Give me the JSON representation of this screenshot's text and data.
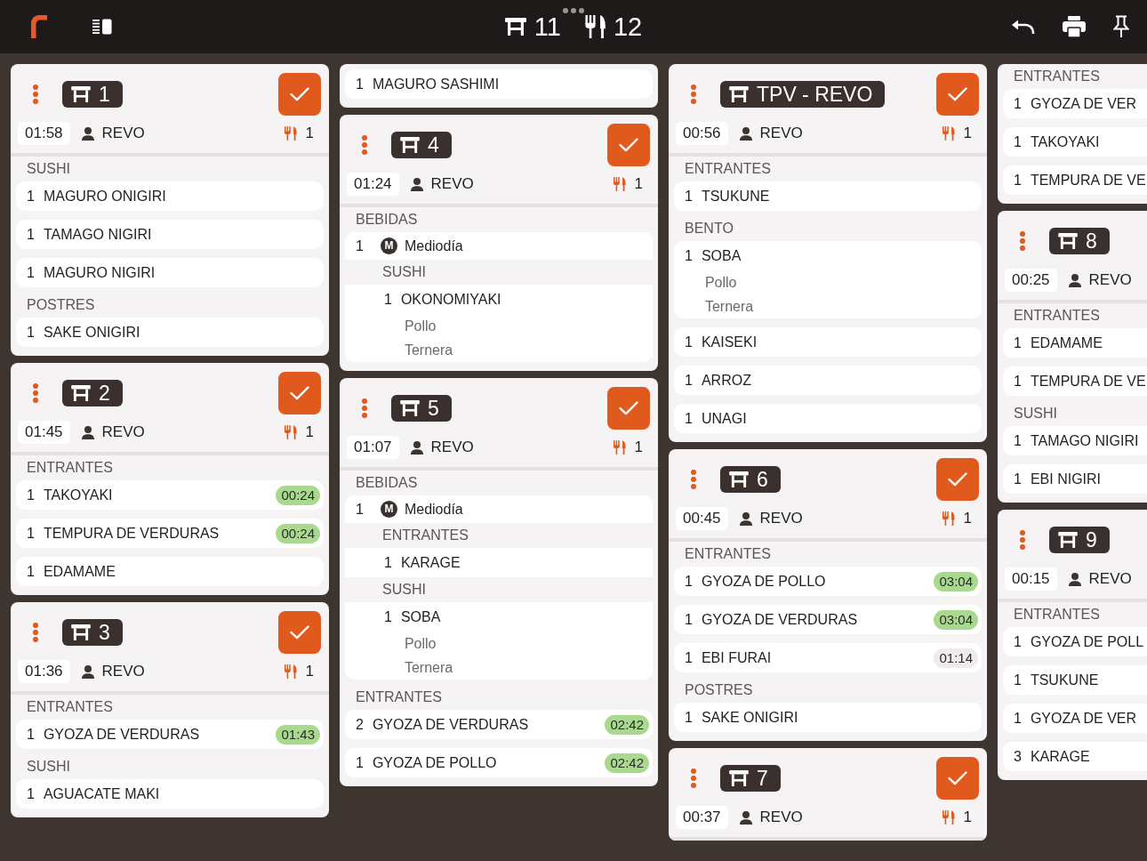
{
  "toolbar": {
    "tables_count": "11",
    "covers_count": "12"
  },
  "columns": [
    {
      "clipped": false,
      "tickets": [
        {
          "kind": "ticket",
          "table": "1",
          "elapsed": "01:58",
          "waiter": "REVO",
          "covers": "1",
          "groups": [
            {
              "course": "SUSHI",
              "items": [
                {
                  "kind": "dish",
                  "qty": "1",
                  "name": "MAGURO ONIGIRI"
                },
                {
                  "kind": "dish",
                  "qty": "1",
                  "name": "TAMAGO NIGIRI"
                },
                {
                  "kind": "dish",
                  "qty": "1",
                  "name": "MAGURO NIGIRI"
                }
              ]
            },
            {
              "course": "POSTRES",
              "items": [
                {
                  "kind": "dish",
                  "qty": "1",
                  "name": "SAKE ONIGIRI"
                }
              ]
            }
          ]
        },
        {
          "kind": "ticket",
          "table": "2",
          "elapsed": "01:45",
          "waiter": "REVO",
          "covers": "1",
          "groups": [
            {
              "course": "ENTRANTES",
              "items": [
                {
                  "kind": "dish",
                  "qty": "1",
                  "name": "TAKOYAKI",
                  "timer": "00:24",
                  "color": "#a8d98e"
                },
                {
                  "kind": "dish",
                  "qty": "1",
                  "name": "TEMPURA DE VERDURAS",
                  "timer": "00:24",
                  "color": "#a8d98e"
                },
                {
                  "kind": "dish",
                  "qty": "1",
                  "name": "EDAMAME"
                }
              ]
            }
          ]
        },
        {
          "kind": "ticket",
          "table": "3",
          "elapsed": "01:36",
          "waiter": "REVO",
          "covers": "1",
          "groups": [
            {
              "course": "ENTRANTES",
              "items": [
                {
                  "kind": "dish",
                  "qty": "1",
                  "name": "GYOZA DE VERDURAS",
                  "timer": "01:43",
                  "color": "#a8d98e"
                }
              ]
            },
            {
              "course": "SUSHI",
              "items": [
                {
                  "kind": "dish",
                  "qty": "1",
                  "name": "AGUACATE MAKI"
                }
              ]
            }
          ]
        }
      ]
    },
    {
      "clipped": false,
      "tickets": [
        {
          "kind": "continuation",
          "groups": [
            {
              "items": [
                {
                  "kind": "dish",
                  "qty": "1",
                  "name": "MAGURO SASHIMI"
                }
              ]
            }
          ]
        },
        {
          "kind": "ticket",
          "table": "4",
          "elapsed": "01:24",
          "waiter": "REVO",
          "covers": "1",
          "groups": [
            {
              "course": "BEBIDAS",
              "items": [
                {
                  "kind": "menu",
                  "qty": "1",
                  "badge": "M",
                  "name": "Mediodía",
                  "sections": [
                    {
                      "course": "SUSHI",
                      "items": [
                        {
                          "kind": "dish",
                          "qty": "1",
                          "name": "OKONOMIYAKI",
                          "modifiers": [
                            "Pollo",
                            "Ternera"
                          ]
                        }
                      ]
                    }
                  ]
                }
              ]
            }
          ]
        },
        {
          "kind": "ticket",
          "table": "5",
          "elapsed": "01:07",
          "waiter": "REVO",
          "covers": "1",
          "groups": [
            {
              "course": "BEBIDAS",
              "items": [
                {
                  "kind": "menu",
                  "qty": "1",
                  "badge": "M",
                  "name": "Mediodía",
                  "sections": [
                    {
                      "course": "ENTRANTES",
                      "items": [
                        {
                          "kind": "dish",
                          "qty": "1",
                          "name": "KARAGE"
                        }
                      ]
                    },
                    {
                      "course": "SUSHI",
                      "items": [
                        {
                          "kind": "dish",
                          "qty": "1",
                          "name": "SOBA",
                          "modifiers": [
                            "Pollo",
                            "Ternera"
                          ]
                        }
                      ]
                    }
                  ]
                }
              ]
            },
            {
              "course": "ENTRANTES",
              "items": [
                {
                  "kind": "dish",
                  "qty": "2",
                  "name": "GYOZA DE VERDURAS",
                  "timer": "02:42",
                  "color": "#a8d98e"
                },
                {
                  "kind": "dish",
                  "qty": "1",
                  "name": "GYOZA DE POLLO",
                  "timer": "02:42",
                  "color": "#a8d98e"
                }
              ]
            }
          ]
        }
      ]
    },
    {
      "clipped": false,
      "tickets": [
        {
          "kind": "ticket",
          "table": "TPV - REVO",
          "elapsed": "00:56",
          "waiter": "REVO",
          "covers": "1",
          "groups": [
            {
              "course": "ENTRANTES",
              "items": [
                {
                  "kind": "dish",
                  "qty": "1",
                  "name": "TSUKUNE"
                }
              ]
            },
            {
              "course": "BENTO",
              "items": [
                {
                  "kind": "dish",
                  "qty": "1",
                  "name": "SOBA",
                  "modifiers": [
                    "Pollo",
                    "Ternera"
                  ]
                },
                {
                  "kind": "dish",
                  "qty": "1",
                  "name": "KAISEKI"
                },
                {
                  "kind": "dish",
                  "qty": "1",
                  "name": "ARROZ"
                },
                {
                  "kind": "dish",
                  "qty": "1",
                  "name": "UNAGI"
                }
              ]
            }
          ]
        },
        {
          "kind": "ticket",
          "table": "6",
          "elapsed": "00:45",
          "waiter": "REVO",
          "covers": "1",
          "groups": [
            {
              "course": "ENTRANTES",
              "items": [
                {
                  "kind": "dish",
                  "qty": "1",
                  "name": "GYOZA DE POLLO",
                  "timer": "03:04",
                  "color": "#a8d98e"
                },
                {
                  "kind": "dish",
                  "qty": "1",
                  "name": "GYOZA DE VERDURAS",
                  "timer": "03:04",
                  "color": "#a8d98e"
                },
                {
                  "kind": "dish",
                  "qty": "1",
                  "name": "EBI FURAI",
                  "timer": "01:14",
                  "color": "#eeebea"
                }
              ]
            },
            {
              "course": "POSTRES",
              "items": [
                {
                  "kind": "dish",
                  "qty": "1",
                  "name": "SAKE ONIGIRI"
                }
              ]
            }
          ]
        },
        {
          "kind": "ticket",
          "table": "7",
          "elapsed": "00:37",
          "waiter": "REVO",
          "covers": "1"
        }
      ]
    },
    {
      "clipped": true,
      "tickets": [
        {
          "kind": "continuation",
          "groups": [
            {
              "course": "ENTRANTES",
              "items": [
                {
                  "kind": "dish",
                  "qty": "1",
                  "name": "GYOZA DE VER"
                },
                {
                  "kind": "dish",
                  "qty": "1",
                  "name": "TAKOYAKI"
                },
                {
                  "kind": "dish",
                  "qty": "1",
                  "name": "TEMPURA DE VE"
                }
              ]
            }
          ]
        },
        {
          "kind": "ticket",
          "table": "8",
          "elapsed": "00:25",
          "waiter": "REVO",
          "groups": [
            {
              "course": "ENTRANTES",
              "items": [
                {
                  "kind": "dish",
                  "qty": "1",
                  "name": "EDAMAME"
                },
                {
                  "kind": "dish",
                  "qty": "1",
                  "name": "TEMPURA DE VE"
                }
              ]
            },
            {
              "course": "SUSHI",
              "items": [
                {
                  "kind": "dish",
                  "qty": "1",
                  "name": "TAMAGO NIGIRI"
                },
                {
                  "kind": "dish",
                  "qty": "1",
                  "name": "EBI NIGIRI"
                }
              ]
            }
          ]
        },
        {
          "kind": "ticket",
          "table": "9",
          "elapsed": "00:15",
          "waiter": "REVO",
          "groups": [
            {
              "course": "ENTRANTES",
              "items": [
                {
                  "kind": "dish",
                  "qty": "1",
                  "name": "GYOZA DE POLL"
                },
                {
                  "kind": "dish",
                  "qty": "1",
                  "name": "TSUKUNE"
                },
                {
                  "kind": "dish",
                  "qty": "1",
                  "name": "GYOZA DE VER"
                },
                {
                  "kind": "dish",
                  "qty": "3",
                  "name": "KARAGE"
                }
              ]
            }
          ]
        }
      ]
    }
  ]
}
